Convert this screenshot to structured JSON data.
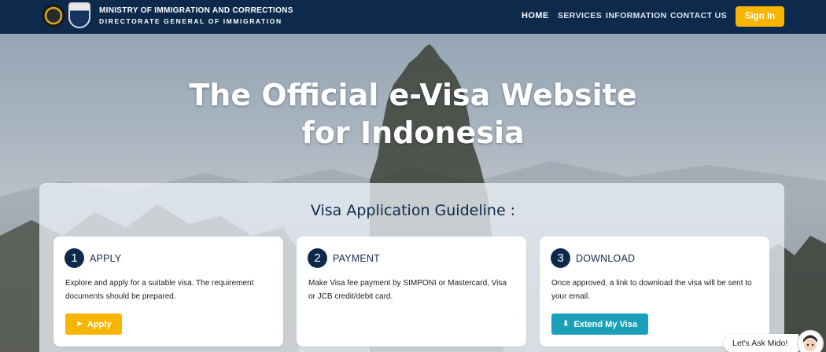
{
  "header": {
    "ministry": "MINISTRY OF IMMIGRATION AND CORRECTIONS",
    "directorate": "DIRECTORATE GENERAL OF IMMIGRATION",
    "nav": [
      "HOME",
      "SERVICES",
      "INFORMATION",
      "CONTACT US"
    ],
    "signin_label": "Sign In",
    "logos": [
      "garuda-emblem",
      "immigration-shield-emblem"
    ]
  },
  "hero": {
    "title_line1": "The Official e-Visa Website",
    "title_line2": "for Indonesia"
  },
  "guideline": {
    "title": "Visa Application Guideline :",
    "steps": [
      {
        "number": "1",
        "title": "APPLY",
        "description": "Explore and apply for a suitable visa. The requirement documents should be prepared.",
        "button_label": "Apply",
        "button_icon": "paper-plane-icon"
      },
      {
        "number": "2",
        "title": "PAYMENT",
        "description": "Make Visa fee payment by SIMPONI or Mastercard, Visa or JCB credit/debit card."
      },
      {
        "number": "3",
        "title": "DOWNLOAD",
        "description": "Once approved, a link to download the visa will be sent to your email.",
        "button_label": "Extend My Visa",
        "button_icon": "download-icon"
      }
    ]
  },
  "chat": {
    "label": "Let's Ask Mido!"
  },
  "colors": {
    "navy": "#0d2a4d",
    "accent_yellow": "#f7b500",
    "accent_teal": "#1aa0b8"
  }
}
